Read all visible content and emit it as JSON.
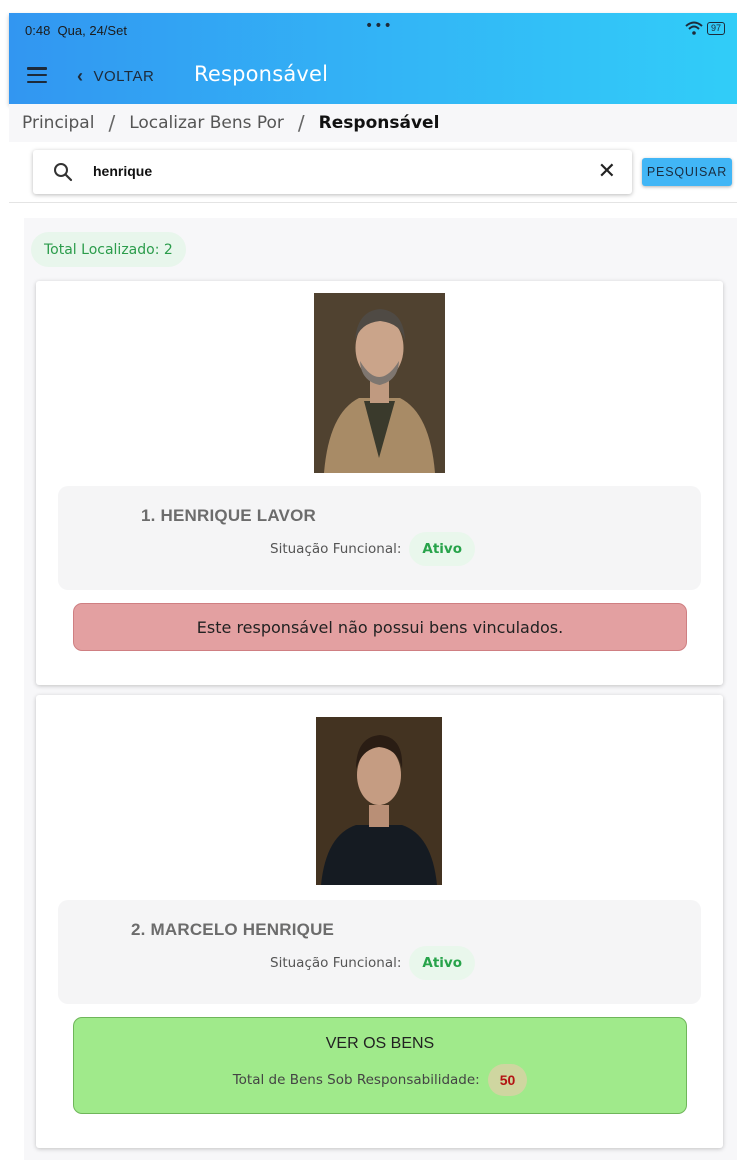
{
  "status_bar": {
    "time": "0:48",
    "date": "Qua, 24/Set",
    "center_dots": "•••",
    "battery": "97"
  },
  "header": {
    "back_label": "VOLTAR",
    "title": "Responsável",
    "gradient_start": "#3296f1",
    "gradient_end": "#31cdf8"
  },
  "breadcrumb": {
    "items": [
      "Principal",
      "Localizar Bens Por",
      "Responsável"
    ],
    "separator": "/"
  },
  "search": {
    "value": "henrique",
    "button_label": "PESQUISAR"
  },
  "results": {
    "total_label": "Total Localizado: 2",
    "cards": [
      {
        "name": "1. HENRIQUE LAVOR",
        "status_label": "Situação Funcional:",
        "status_value": "Ativo",
        "alert_text": "Este responsável não possui bens vinculados."
      },
      {
        "name": "2. MARCELO HENRIQUE",
        "status_label": "Situação Funcional:",
        "status_value": "Ativo",
        "button_title": "VER OS BENS",
        "total_label": "Total de Bens Sob Responsabilidade:",
        "total_count": "50"
      }
    ]
  },
  "colors": {
    "alert_bg": "#e3a0a1",
    "action_bg": "#a0ea8b",
    "active_green": "#27a34a",
    "count_red": "#b31313"
  }
}
